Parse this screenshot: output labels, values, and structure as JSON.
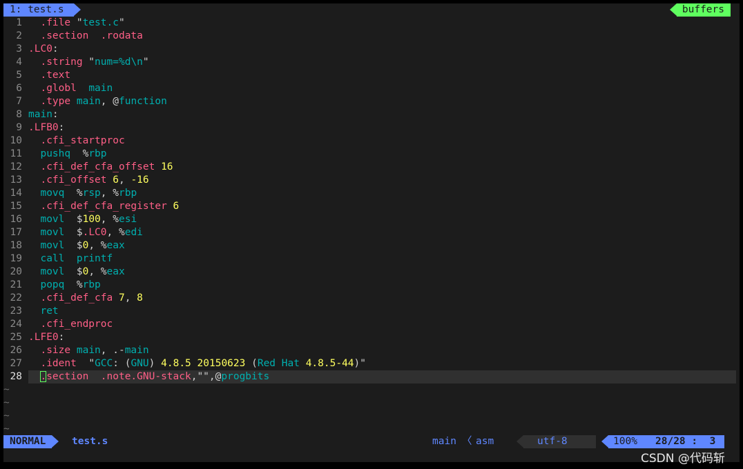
{
  "tabline": {
    "active_tab": "1: test.s",
    "right_label": "buffers"
  },
  "lines": [
    {
      "n": "1"
    },
    {
      "n": "2"
    },
    {
      "n": "3"
    },
    {
      "n": "4"
    },
    {
      "n": "5"
    },
    {
      "n": "6"
    },
    {
      "n": "7"
    },
    {
      "n": "8"
    },
    {
      "n": "9"
    },
    {
      "n": "10"
    },
    {
      "n": "11"
    },
    {
      "n": "12"
    },
    {
      "n": "13"
    },
    {
      "n": "14"
    },
    {
      "n": "15"
    },
    {
      "n": "16"
    },
    {
      "n": "17"
    },
    {
      "n": "18"
    },
    {
      "n": "19"
    },
    {
      "n": "20"
    },
    {
      "n": "21"
    },
    {
      "n": "22"
    },
    {
      "n": "23"
    },
    {
      "n": "24"
    },
    {
      "n": "25"
    },
    {
      "n": "26"
    },
    {
      "n": "27"
    },
    {
      "n": "28"
    }
  ],
  "code": {
    "l1": [
      ".file",
      " \"",
      "test.c",
      "\""
    ],
    "l2": [
      ".section",
      "  .rodata"
    ],
    "l3": [
      ".LC0",
      ":"
    ],
    "l4": [
      ".string",
      " \"",
      "num=",
      "%d",
      "\\n",
      "\""
    ],
    "l5": [
      ".text"
    ],
    "l6": [
      ".globl",
      "  main"
    ],
    "l7": [
      ".type",
      " main",
      ", @",
      "function"
    ],
    "l8": [
      "main",
      ":"
    ],
    "l9": [
      ".LFB0",
      ":"
    ],
    "l10": [
      ".cfi_startproc"
    ],
    "l11": [
      "pushq",
      "  %",
      "rbp"
    ],
    "l12": [
      ".cfi_def_cfa_offset",
      " ",
      "16"
    ],
    "l13": [
      ".cfi_offset",
      " ",
      "6",
      ", ",
      "-16"
    ],
    "l14": [
      "movq",
      "  %",
      "rsp",
      ", %",
      "rbp"
    ],
    "l15": [
      ".cfi_def_cfa_register",
      " ",
      "6"
    ],
    "l16": [
      "movl",
      "  $",
      "100",
      ", %",
      "esi"
    ],
    "l17": [
      "movl",
      "  $",
      ".LC0",
      ", %",
      "edi"
    ],
    "l18": [
      "movl",
      "  $",
      "0",
      ", %",
      "eax"
    ],
    "l19": [
      "call",
      "  printf"
    ],
    "l20": [
      "movl",
      "  $",
      "0",
      ", %",
      "eax"
    ],
    "l21": [
      "popq",
      "  %",
      "rbp"
    ],
    "l22": [
      ".cfi_def_cfa",
      " ",
      "7",
      ", ",
      "8"
    ],
    "l23": [
      "ret"
    ],
    "l24": [
      ".cfi_endproc"
    ],
    "l25": [
      ".LFE0",
      ":"
    ],
    "l26": [
      ".size",
      " main",
      ", .-",
      "main"
    ],
    "l27": [
      ".ident",
      "  \"",
      "GCC",
      ": (",
      "GNU",
      ") ",
      "4.8.5",
      " ",
      "20150623",
      " (",
      "Red Hat",
      " ",
      "4.8.5-44",
      ")\""
    ],
    "l28": [
      ".",
      "section",
      "  .note.GNU-stack",
      ",\"\",@",
      "progbits"
    ]
  },
  "tildes": [
    "~",
    "~",
    "~",
    "~"
  ],
  "statusline": {
    "mode": "NORMAL",
    "filename": "test.s",
    "function": "main",
    "separator": "〈",
    "filetype": "asm",
    "encoding": "utf-8",
    "percent": "100%",
    "position": "28/28 :  3"
  },
  "watermark": "CSDN @代码斩",
  "colors": {
    "background": "#1c1c1c",
    "accent_blue": "#5f87ff",
    "accent_green": "#5fff5f",
    "directive": "#ff5f87",
    "identifier": "#00afaf",
    "number": "#ffff5f"
  }
}
